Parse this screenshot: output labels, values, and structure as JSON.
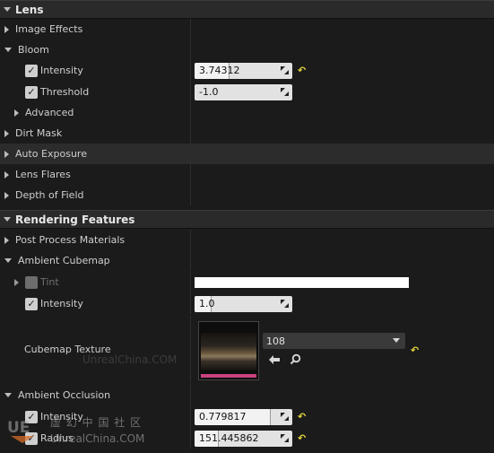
{
  "sections": {
    "lens": "Lens",
    "rendering_features": "Rendering Features"
  },
  "lens": {
    "image_effects": "Image Effects",
    "bloom": "Bloom",
    "bloom_intensity_label": "Intensity",
    "bloom_intensity_value": "3.74312",
    "bloom_intensity_fill": 0.36,
    "bloom_threshold_label": "Threshold",
    "bloom_threshold_value": "-1.0",
    "advanced": "Advanced",
    "dirt_mask": "Dirt Mask",
    "auto_exposure": "Auto Exposure",
    "lens_flares": "Lens Flares",
    "depth_of_field": "Depth of Field"
  },
  "rendering": {
    "post_process_materials": "Post Process Materials",
    "ambient_cubemap": "Ambient Cubemap",
    "tint_label": "Tint",
    "tint_color": "#ffffff",
    "cubemap_intensity_label": "Intensity",
    "cubemap_intensity_value": "1.0",
    "cubemap_intensity_fill": 0.17,
    "cubemap_texture_label": "Cubemap Texture",
    "cubemap_texture_value": "108",
    "ambient_occlusion": "Ambient Occlusion",
    "ao_intensity_label": "Intensity",
    "ao_intensity_value": "0.779817",
    "ao_intensity_fill": 0.78,
    "ao_radius_label": "Radius",
    "ao_radius_value": "151.445862",
    "ao_radius_fill": 0.25
  },
  "icons": {
    "reset": "reset-to-default-icon",
    "use_selected": "arrow-left-icon",
    "browse": "search-icon"
  },
  "watermark": {
    "cn_text": "虚 幻 中 国 社 区",
    "site": "UnrealChina.COM",
    "site_faint": "UnrealChina.COM"
  },
  "colors": {
    "reset_icon": "#e4d53b",
    "texture_bar": "#c9427f"
  }
}
